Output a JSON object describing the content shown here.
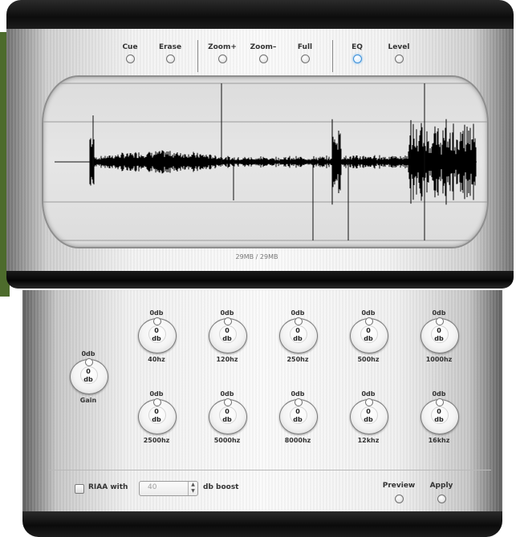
{
  "toolbar": {
    "cue": "Cue",
    "erase": "Erase",
    "zoom_in": "Zoom+",
    "zoom_out": "Zoom–",
    "full": "Full",
    "eq": "EQ",
    "level": "Level"
  },
  "waveform": {
    "file_size": "29MB / 29MB"
  },
  "eq": {
    "gain": {
      "top": "0db",
      "value": "0",
      "unit": "db",
      "label": "Gain"
    },
    "bands": [
      {
        "top": "0db",
        "value": "0",
        "unit": "db",
        "label": "40hz"
      },
      {
        "top": "0db",
        "value": "0",
        "unit": "db",
        "label": "120hz"
      },
      {
        "top": "0db",
        "value": "0",
        "unit": "db",
        "label": "250hz"
      },
      {
        "top": "0db",
        "value": "0",
        "unit": "db",
        "label": "500hz"
      },
      {
        "top": "0db",
        "value": "0",
        "unit": "db",
        "label": "1000hz"
      },
      {
        "top": "0db",
        "value": "0",
        "unit": "db",
        "label": "2500hz"
      },
      {
        "top": "0db",
        "value": "0",
        "unit": "db",
        "label": "5000hz"
      },
      {
        "top": "0db",
        "value": "0",
        "unit": "db",
        "label": "8000hz"
      },
      {
        "top": "0db",
        "value": "0",
        "unit": "db",
        "label": "12khz"
      },
      {
        "top": "0db",
        "value": "0",
        "unit": "db",
        "label": "16khz"
      }
    ]
  },
  "riaa": {
    "label": "RIAA with",
    "boost_value": "40",
    "boost_label": "db boost"
  },
  "actions": {
    "preview": "Preview",
    "apply": "Apply"
  },
  "colors": {
    "active_indicator": "#3a8fd8"
  }
}
